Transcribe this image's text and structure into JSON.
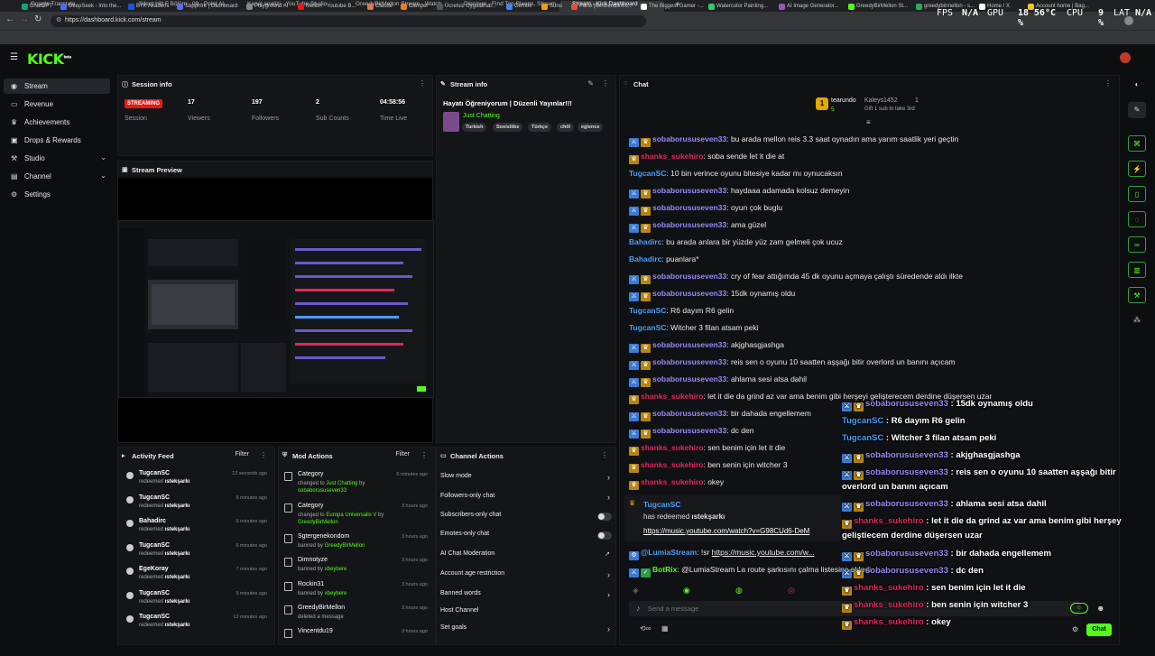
{
  "browser": {
    "tabs": [
      {
        "label": "Google Translate",
        "color": "#4285f4"
      },
      {
        "label": "Silent Hill F Bölüm - 09 - Polat Al...",
        "color": "#e91916"
      },
      {
        "label": "Kanal analizi - YouTube Studio",
        "color": "#e91916"
      },
      {
        "label": "GreedyBirMellon Stream - Watch...",
        "color": "#53fc18"
      },
      {
        "label": "Discover - Find Top Bleeps, Stream...",
        "color": "#e91916"
      },
      {
        "label": "Stream - Kick Dashboard",
        "color": "#53fc18"
      }
    ],
    "url": "https://dashboard.kick.com/stream",
    "bookmarks": [
      "ChatGPT",
      "DeepSeek - Into the...",
      "BTK Akademi",
      "Sapphire | Dashboard",
      "Playground AI",
      "Mellon - Youtube B...",
      "Claude",
      "Camper",
      "Ücretsiz Uygulamal...",
      "Gemini",
      "Suno",
      "Pano (bentrendlim.c...",
      "The Biggest Gamer -...",
      "Watercolor Painting...",
      "AI Image Generator...",
      "GreedyBirMellon St...",
      "greedybirmellon - s...",
      "Home / X",
      "Account home | Bag..."
    ]
  },
  "perf_overlay": {
    "fps_label": "FPS",
    "fps": "N/A",
    "gpu_label": "GPU",
    "gpu": "18 %",
    "gpu_temp": "56°C",
    "cpu_label": "CPU",
    "cpu": "9 %",
    "lat_label": "LAT",
    "lat": "N/A"
  },
  "app": {
    "logo": "KICK",
    "logo_sup": "beta"
  },
  "sidebar": {
    "items": [
      {
        "label": "Stream",
        "icon": "broadcast-icon"
      },
      {
        "label": "Revenue",
        "icon": "wallet-icon"
      },
      {
        "label": "Achievements",
        "icon": "trophy-icon"
      },
      {
        "label": "Drops & Rewards",
        "icon": "gift-icon"
      },
      {
        "label": "Studio",
        "icon": "studio-icon"
      },
      {
        "label": "Channel",
        "icon": "channel-icon"
      },
      {
        "label": "Settings",
        "icon": "gear-icon"
      }
    ]
  },
  "session": {
    "title": "Session info",
    "status": "STREAMING",
    "status_label": "Session",
    "stats": [
      {
        "value": "17",
        "label": "Viewers"
      },
      {
        "value": "197",
        "label": "Followers"
      },
      {
        "value": "2",
        "label": "Sub Counts"
      },
      {
        "value": "04:58:56",
        "label": "Time Live"
      }
    ]
  },
  "stream_info": {
    "title": "Stream info",
    "stream_title": "Hayatı Öğreniyorum | Düzenli Yayınlar!!!",
    "category": "Just Chatting",
    "tags": [
      "Turkish",
      "Sosisliike",
      "Türkçe",
      "chill",
      "eglence"
    ]
  },
  "preview": {
    "title": "Stream Preview"
  },
  "activity": {
    "title": "Activity Feed",
    "filter": "Filter",
    "rows": [
      {
        "name": "TugcanSC",
        "action": "redeemed",
        "item": "ıstekşarkı",
        "time": "13 seconds ago"
      },
      {
        "name": "TugcanSC",
        "action": "redeemed",
        "item": "ıstekşarkı",
        "time": "6 minutes ago"
      },
      {
        "name": "Bahadirc",
        "action": "redeemed",
        "item": "ıstekşarkı",
        "time": "6 minutes ago"
      },
      {
        "name": "TugcanSC",
        "action": "redeemed",
        "item": "ıstekşarkı",
        "time": "6 minutes ago"
      },
      {
        "name": "EgeKoray",
        "action": "redeemed",
        "item": "ıstekşarkı",
        "time": "7 minutes ago"
      },
      {
        "name": "TugcanSC",
        "action": "redeemed",
        "item": "ıstekşarkı",
        "time": "9 minutes ago"
      },
      {
        "name": "TugcanSC",
        "action": "redeemed",
        "item": "ıstekşarkı",
        "time": "12 minutes ago"
      }
    ]
  },
  "mod_actions": {
    "title": "Mod Actions",
    "filter": "Filter",
    "rows": [
      {
        "name": "Category",
        "line1": "changed to ",
        "hl": "Just Chatting",
        "line2": " by ",
        "by": "sobaborususeven33",
        "time": "6 minutes ago"
      },
      {
        "name": "Category",
        "line1": "changed to ",
        "hl": "Europa Universalis V",
        "line2": " by ",
        "by": "GreedyBirMellon",
        "time": "3 hours ago"
      },
      {
        "name": "Sgtergenekondom",
        "line1": "banned by ",
        "hl": "",
        "line2": "",
        "by": "GreedyBirMellon",
        "time": "3 hours ago"
      },
      {
        "name": "Dimnotyze",
        "line1": "banned by ",
        "hl": "",
        "line2": "",
        "by": "xbeybere",
        "time": "3 hours ago"
      },
      {
        "name": "Rockin31",
        "line1": "banned by ",
        "hl": "",
        "line2": "",
        "by": "xbeybere",
        "time": "3 hours ago"
      },
      {
        "name": "GreedyBirMellon",
        "line1": "deleted a message",
        "hl": "",
        "line2": "",
        "by": "",
        "time": "3 hours ago"
      },
      {
        "name": "Vincentdu19",
        "line1": "",
        "hl": "",
        "line2": "",
        "by": "",
        "time": "3 hours ago"
      }
    ]
  },
  "channel_actions": {
    "title": "Channel Actions",
    "rows": [
      {
        "label": "Slow mode",
        "ctl": "chevron"
      },
      {
        "label": "Followers-only chat",
        "ctl": "chevron"
      },
      {
        "label": "Subscribers-only chat",
        "ctl": "toggle"
      },
      {
        "label": "Emotes-only chat",
        "ctl": "toggle"
      },
      {
        "label": "AI Chat Moderation",
        "ctl": "external"
      },
      {
        "label": "Account age restriction",
        "ctl": "chevron"
      },
      {
        "label": "Banned words",
        "ctl": "chevron"
      },
      {
        "label": "Host Channel",
        "ctl": "none"
      },
      {
        "label": "Set goals",
        "ctl": "chevron"
      }
    ]
  },
  "chat": {
    "title": "Chat",
    "pinned": {
      "user1": "tearundo",
      "count1": "5",
      "user2": "Kaleys1452",
      "count2": "1",
      "gift_text": "Gift 1 sub to take 3rd"
    },
    "messages": [
      {
        "user": "sobaborususeven33",
        "color": "#9b87f5",
        "badges": [
          "b",
          "c"
        ],
        "sep": ": ",
        "text": "bu arada mellon reis 3.3 saat oynadın ama yarım saatlik yeri geçtin"
      },
      {
        "user": "shanks_sukehiro",
        "color": "#e5255b",
        "badges": [
          "c"
        ],
        "sep": ": ",
        "text": "soba sende let it die at"
      },
      {
        "user": "TugcanSC",
        "color": "#4a9df8",
        "badges": [],
        "sep": ": ",
        "text": "10 bin verince oyunu bitesiye kadar mı oynucaksın"
      },
      {
        "user": "sobaborususeven33",
        "color": "#9b87f5",
        "badges": [
          "b",
          "c"
        ],
        "sep": ": ",
        "text": "haydaaa adamada kolsuz demeyin"
      },
      {
        "user": "sobaborususeven33",
        "color": "#9b87f5",
        "badges": [
          "b",
          "c"
        ],
        "sep": ": ",
        "text": "oyun çok buglu"
      },
      {
        "user": "sobaborususeven33",
        "color": "#9b87f5",
        "badges": [
          "b",
          "c"
        ],
        "sep": ": ",
        "text": "ama güzel"
      },
      {
        "user": "Bahadirc",
        "color": "#4a9df8",
        "badges": [],
        "sep": ": ",
        "text": "bu arada anlara bir yüzde yüz zam gelmeli çok ucuz"
      },
      {
        "user": "Bahadirc",
        "color": "#4a9df8",
        "badges": [],
        "sep": ": ",
        "text": "puanlara*"
      },
      {
        "user": "sobaborususeven33",
        "color": "#9b87f5",
        "badges": [
          "b",
          "c"
        ],
        "sep": ": ",
        "text": "cry of fear attığımda 45 dk oyunu açmaya çalıştı süredende aldı ilkte"
      },
      {
        "user": "sobaborususeven33",
        "color": "#9b87f5",
        "badges": [
          "b",
          "c"
        ],
        "sep": ": ",
        "text": "15dk oynamış oldu"
      },
      {
        "user": "TugcanSC",
        "color": "#4a9df8",
        "badges": [],
        "sep": ": ",
        "text": "R6 dayım R6 gelin"
      },
      {
        "user": "TugcanSC",
        "color": "#4a9df8",
        "badges": [],
        "sep": ": ",
        "text": "Witcher 3 filan atsam peki"
      },
      {
        "user": "sobaborususeven33",
        "color": "#9b87f5",
        "badges": [
          "b",
          "c"
        ],
        "sep": ": ",
        "text": "akjghasgjashga"
      },
      {
        "user": "sobaborususeven33",
        "color": "#9b87f5",
        "badges": [
          "b",
          "c"
        ],
        "sep": ": ",
        "text": "reis sen o oyunu 10 saatten aşşağı bitir overlord un banını açıcam"
      },
      {
        "user": "sobaborususeven33",
        "color": "#9b87f5",
        "badges": [
          "b",
          "c"
        ],
        "sep": ": ",
        "text": "ahlama sesi atsa dahil"
      },
      {
        "user": "shanks_sukehiro",
        "color": "#e5255b",
        "badges": [
          "c"
        ],
        "sep": ": ",
        "text": "let it die da grind az var ama benim gibi herşeyi gelişterecem derdine düşersen uzar"
      },
      {
        "user": "sobaborususeven33",
        "color": "#9b87f5",
        "badges": [
          "b",
          "c"
        ],
        "sep": ": ",
        "text": "bir dahada engellemem"
      },
      {
        "user": "sobaborususeven33",
        "color": "#9b87f5",
        "badges": [
          "b",
          "c"
        ],
        "sep": ": ",
        "text": "dc den"
      },
      {
        "user": "shanks_sukehiro",
        "color": "#e5255b",
        "badges": [
          "c"
        ],
        "sep": ": ",
        "text": "sen benim için let it die"
      },
      {
        "user": "shanks_sukehiro",
        "color": "#e5255b",
        "badges": [
          "c"
        ],
        "sep": ": ",
        "text": "ben senin için witcher 3"
      },
      {
        "user": "shanks_sukehiro",
        "color": "#e5255b",
        "badges": [
          "c"
        ],
        "sep": ": ",
        "text": "okey"
      }
    ],
    "redeem": {
      "user": "TugcanSC",
      "text": "has redeemed ",
      "item": "ıstekşarkı",
      "link": "https://music.youtube.com/watch?v=G98CUd6-DeM"
    },
    "bot1": {
      "user": "@LumiaStream",
      "text": ": !sr ",
      "link": "https://music.youtube.com/w..."
    },
    "bot2": {
      "user": "BotRix",
      "text": ": @LumiaStream La route şarkısını çalma listesine ekledi"
    },
    "input_placeholder": "Send a message",
    "send_label": "Chat"
  },
  "overlay_chat": [
    {
      "user": "sobaborususeven33",
      "color": "#9b87f5",
      "badges": [
        "b",
        "c"
      ],
      "text": " : 15dk oynamış oldu"
    },
    {
      "user": "TugcanSC",
      "color": "#4a9df8",
      "badges": [],
      "text": " : R6 dayım R6 gelin"
    },
    {
      "user": "TugcanSC",
      "color": "#4a9df8",
      "badges": [],
      "text": " : Witcher 3 filan atsam peki"
    },
    {
      "user": "sobaborususeven33",
      "color": "#9b87f5",
      "badges": [
        "b",
        "c"
      ],
      "text": " : akjghasgjashga"
    },
    {
      "user": "sobaborususeven33",
      "color": "#9b87f5",
      "badges": [
        "b",
        "c"
      ],
      "text": " : reis sen o oyunu 10 saatten aşşağı bitir"
    },
    {
      "user": "",
      "color": "#ffffff",
      "badges": [],
      "text": "overlord un banını açıcam"
    },
    {
      "user": "sobaborususeven33",
      "color": "#9b87f5",
      "badges": [
        "b",
        "c"
      ],
      "text": " : ahlama sesi atsa dahil"
    },
    {
      "user": "shanks_sukehiro",
      "color": "#e5255b",
      "badges": [
        "c"
      ],
      "text": " : let it die da grind az var ama benim gibi herşeyi"
    },
    {
      "user": "",
      "color": "#ffffff",
      "badges": [],
      "text": "geliştiecem derdine düşersen uzar"
    },
    {
      "user": "sobaborususeven33",
      "color": "#9b87f5",
      "badges": [
        "b",
        "c"
      ],
      "text": " : bir dahada engellemem"
    },
    {
      "user": "sobaborususeven33",
      "color": "#9b87f5",
      "badges": [
        "b",
        "c"
      ],
      "text": " : dc den"
    },
    {
      "user": "shanks_sukehiro",
      "color": "#e5255b",
      "badges": [
        "c"
      ],
      "text": " : sen benim için let it die"
    },
    {
      "user": "shanks_sukehiro",
      "color": "#e5255b",
      "badges": [
        "c"
      ],
      "text": " : ben senin için witcher 3"
    },
    {
      "user": "shanks_sukehiro",
      "color": "#e5255b",
      "badges": [
        "c"
      ],
      "text": " : okey"
    }
  ],
  "colors": {
    "accent": "#53fc18",
    "live": "#e91916"
  }
}
